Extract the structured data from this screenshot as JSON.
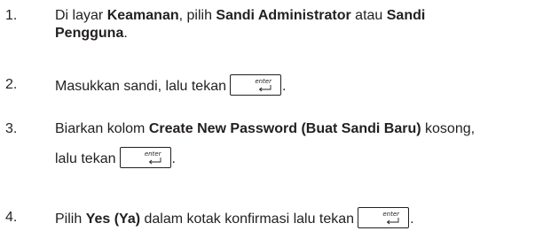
{
  "steps": [
    {
      "number": "1.",
      "line1": {
        "t1": "Di layar ",
        "b1": "Keamanan",
        "t2": ", pilih ",
        "b2": "Sandi Administrator",
        "t3": " atau ",
        "b3": "Sandi"
      },
      "line2": {
        "b1": "Pengguna",
        "t1": "."
      }
    },
    {
      "number": "2.",
      "text": "Masukkan sandi, lalu tekan",
      "after": "."
    },
    {
      "number": "3.",
      "line1": {
        "t1": "Biarkan kolom ",
        "b1": "Create New Password (Buat Sandi Baru)",
        "t2": " kosong,"
      },
      "line2": {
        "t1": "lalu tekan",
        "after": "."
      }
    },
    {
      "number": "4.",
      "t1": "Pilih ",
      "b1": "Yes (Ya)",
      "t2": " dalam kotak konfirmasi lalu tekan",
      "after": "."
    }
  ],
  "key": {
    "label": "enter",
    "icon": "enter-key-icon"
  }
}
